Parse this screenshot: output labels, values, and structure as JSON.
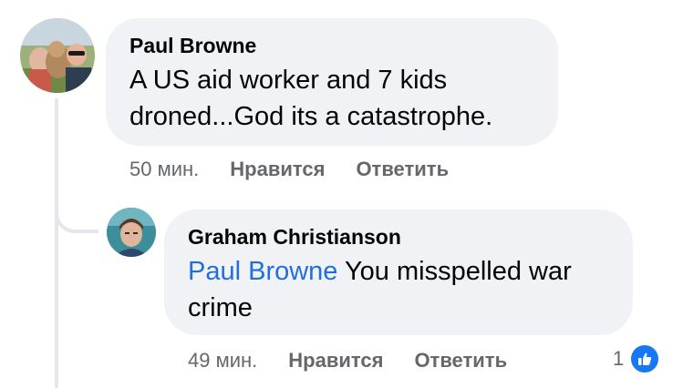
{
  "comment": {
    "author": "Paul Browne",
    "text_line1": "A US aid worker and 7 kids",
    "text_line2": "droned...God its a catastrophe.",
    "time": "50 мин.",
    "like_label": "Нравится",
    "reply_label": "Ответить"
  },
  "reply": {
    "author": "Graham Christianson",
    "mention": "Paul Browne",
    "text_rest": " You misspelled war",
    "text_line2": "crime",
    "time": "49 мин.",
    "like_label": "Нравится",
    "reply_label": "Ответить",
    "reaction_count": "1",
    "reaction_icon": "thumbs-up-icon"
  },
  "colors": {
    "bubble": "#f0f2f5",
    "mention": "#216fdb",
    "meta": "#65676b",
    "like": "#1877f2"
  }
}
